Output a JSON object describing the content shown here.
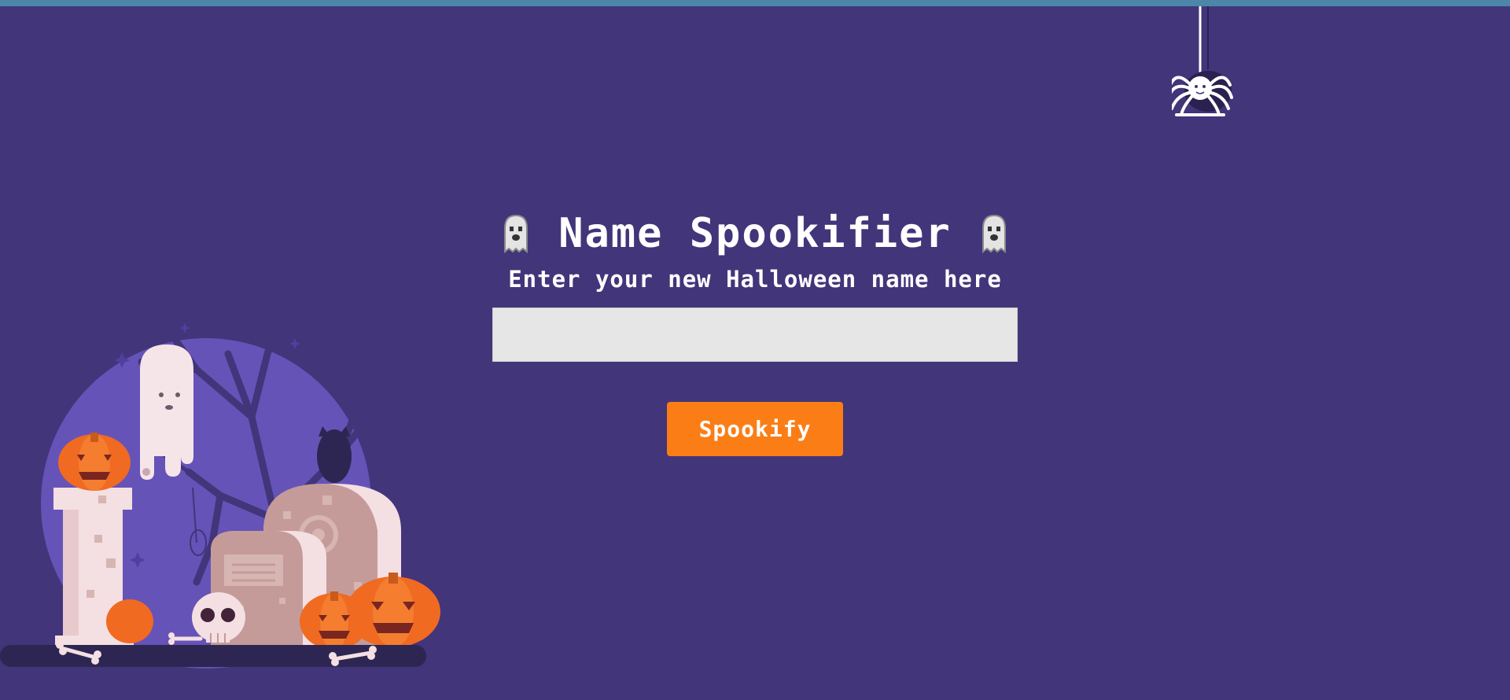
{
  "header": {
    "title": "Name Spookifier",
    "subtitle": "Enter your new Halloween name here"
  },
  "form": {
    "name_value": "",
    "name_placeholder": "",
    "submit_label": "Spookify"
  },
  "decor": {
    "left_icon": "ghost-icon",
    "right_icon": "ghost-icon",
    "top_right": "spider-icon",
    "scene": "graveyard-illustration"
  },
  "colors": {
    "background": "#42357a",
    "top_bar": "#4a87a8",
    "button": "#fb7d16",
    "input": "#e6e6e6",
    "moon": "#6653b8",
    "pumpkin": "#f06a22"
  }
}
